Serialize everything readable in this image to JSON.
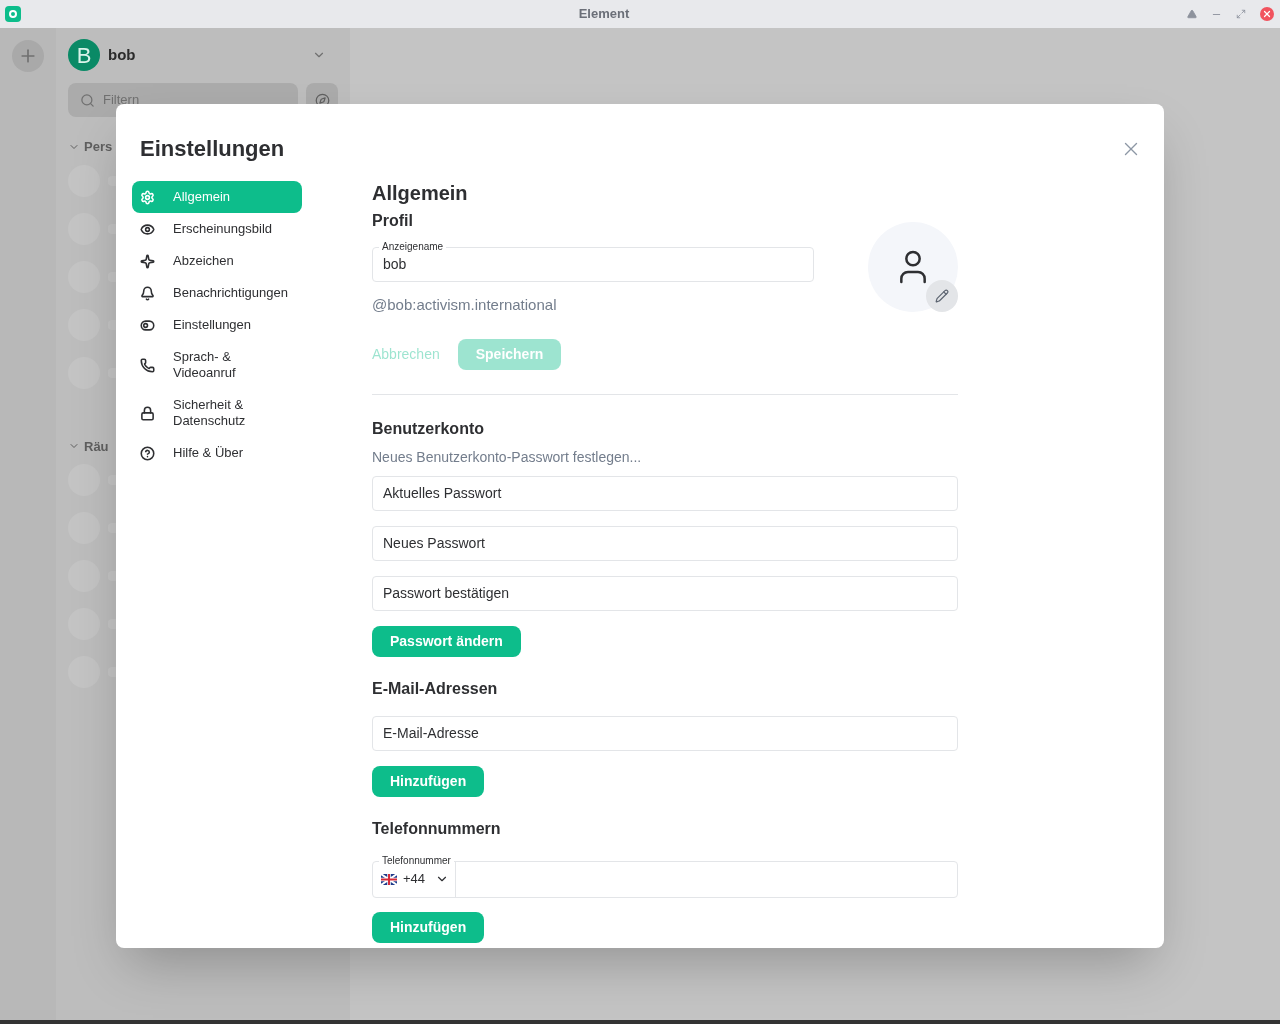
{
  "window": {
    "title": "Element"
  },
  "background": {
    "user": {
      "initial": "B",
      "name": "bob"
    },
    "filter": {
      "placeholder": "Filtern"
    },
    "sections": [
      "Pers",
      "Räu"
    ]
  },
  "dialog": {
    "title": "Einstellungen",
    "nav": [
      {
        "label": "Allgemein",
        "selected": true
      },
      {
        "label": "Erscheinungsbild",
        "selected": false
      },
      {
        "label": "Abzeichen",
        "selected": false
      },
      {
        "label": "Benachrichtigungen",
        "selected": false
      },
      {
        "label": "Einstellungen",
        "selected": false
      },
      {
        "label": "Sprach- & Videoanruf",
        "selected": false
      },
      {
        "label": "Sicherheit & Datenschutz",
        "selected": false
      },
      {
        "label": "Hilfe & Über",
        "selected": false
      }
    ],
    "heading": "Allgemein",
    "profile": {
      "title": "Profil",
      "display_name": {
        "label": "Anzeigename",
        "value": "bob"
      },
      "user_id": "@bob:activism.international",
      "cancel": {
        "label": "Abbrechen",
        "disabled": true
      },
      "save": {
        "label": "Speichern",
        "disabled": true
      }
    },
    "account": {
      "title": "Benutzerkonto",
      "subtitle": "Neues Benutzerkonto-Passwort festlegen...",
      "fields": [
        {
          "placeholder": "Aktuelles Passwort"
        },
        {
          "placeholder": "Neues Passwort"
        },
        {
          "placeholder": "Passwort bestätigen"
        }
      ],
      "button": "Passwort ändern"
    },
    "email": {
      "title": "E-Mail-Adressen",
      "placeholder": "E-Mail-Adresse",
      "button": "Hinzufügen"
    },
    "phone": {
      "title": "Telefonnummern",
      "label": "Telefonnummer",
      "country_code": "+44",
      "button": "Hinzufügen"
    }
  }
}
